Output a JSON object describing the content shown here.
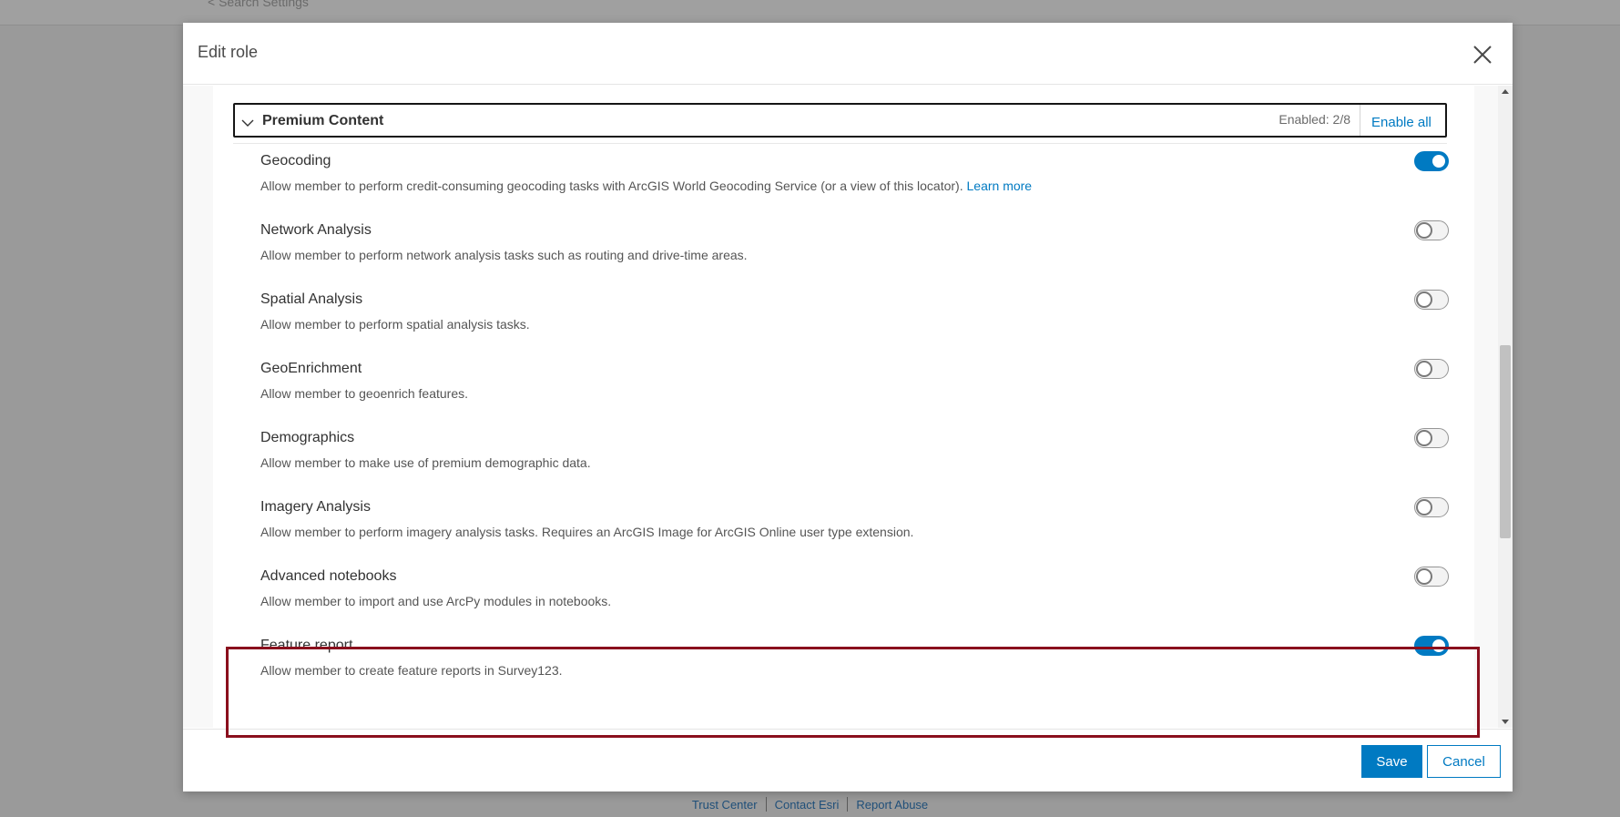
{
  "background": {
    "search_text": "< Search Settings"
  },
  "modal": {
    "title": "Edit role"
  },
  "section": {
    "title": "Premium Content",
    "enabled_count": "Enabled: 2/8",
    "enable_all_label": "Enable all"
  },
  "privileges": [
    {
      "name": "Geocoding",
      "description": "Allow member to perform credit-consuming geocoding tasks with ArcGIS World Geocoding Service (or a view of this locator).",
      "link": "Learn more",
      "enabled": true
    },
    {
      "name": "Network Analysis",
      "description": "Allow member to perform network analysis tasks such as routing and drive-time areas.",
      "enabled": false
    },
    {
      "name": "Spatial Analysis",
      "description": "Allow member to perform spatial analysis tasks.",
      "enabled": false
    },
    {
      "name": "GeoEnrichment",
      "description": "Allow member to geoenrich features.",
      "enabled": false
    },
    {
      "name": "Demographics",
      "description": "Allow member to make use of premium demographic data.",
      "enabled": false
    },
    {
      "name": "Imagery Analysis",
      "description": "Allow member to perform imagery analysis tasks. Requires an ArcGIS Image for ArcGIS Online user type extension.",
      "enabled": false
    },
    {
      "name": "Advanced notebooks",
      "description": "Allow member to import and use ArcPy modules in notebooks.",
      "enabled": false
    },
    {
      "name": "Feature report",
      "description": "Allow member to create feature reports in Survey123.",
      "enabled": true
    }
  ],
  "footer_buttons": {
    "save": "Save",
    "cancel": "Cancel"
  },
  "page_footer": {
    "links": [
      "Trust Center",
      "Contact Esri",
      "Report Abuse"
    ]
  },
  "colors": {
    "accent": "#007ac2",
    "highlight": "#8a0f1d"
  }
}
